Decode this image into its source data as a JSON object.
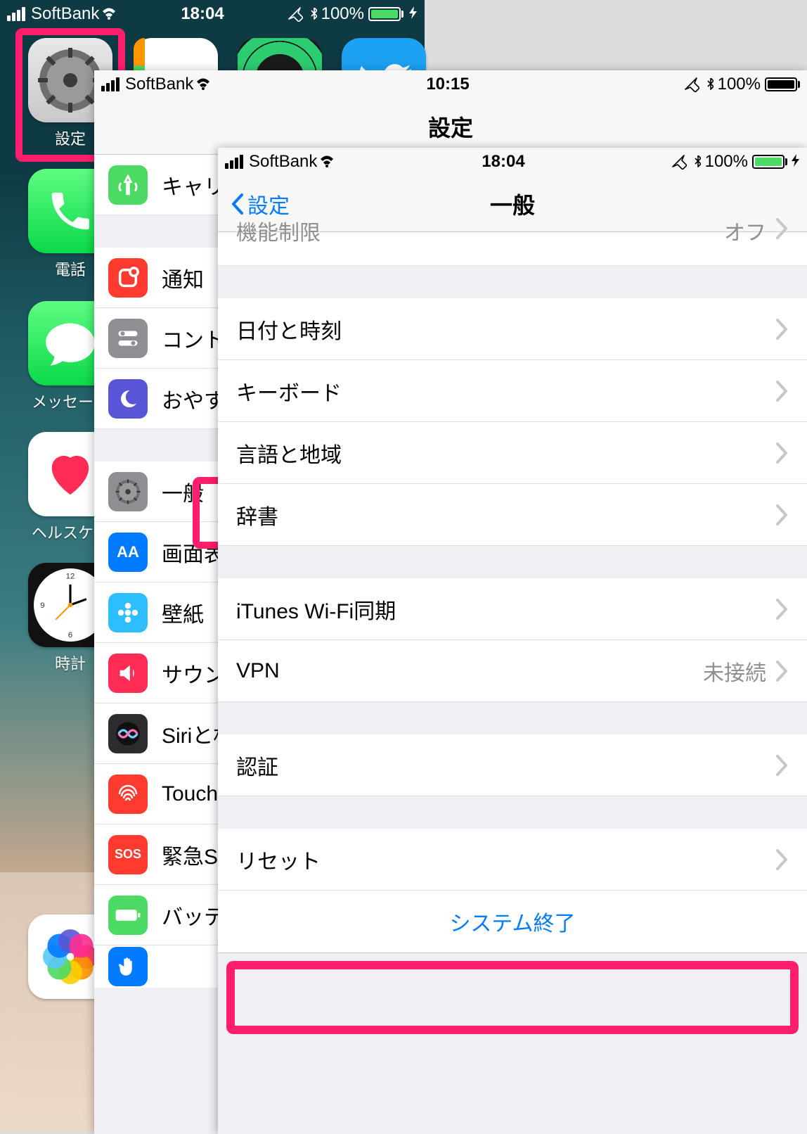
{
  "layer1": {
    "status": {
      "carrier": "SoftBank",
      "time": "18:04",
      "battery_pct": "100%"
    },
    "apps": {
      "settings": "設定",
      "phone": "電話",
      "messages": "メッセー…",
      "health": "ヘルスケ…",
      "clock": "時計"
    }
  },
  "layer2": {
    "status": {
      "carrier": "SoftBank",
      "time": "10:15",
      "battery_pct": "100%"
    },
    "title": "設定",
    "items": {
      "carrier_partial": "キャリ",
      "notifications": "通知",
      "controlcenter": "コント",
      "dnd": "おやす",
      "general": "一般",
      "display": "画面表",
      "wallpaper": "壁紙",
      "sounds": "サウン",
      "siri": "Siriと杉",
      "touchid": "Touch",
      "sos": "緊急SC",
      "battery": "バッテ"
    }
  },
  "layer3": {
    "status": {
      "carrier": "SoftBank",
      "time": "18:04",
      "battery_pct": "100%"
    },
    "back": "設定",
    "title": "一般",
    "rows": {
      "restrictions_partial": "機能制限",
      "restrictions_value": "オフ",
      "datetime": "日付と時刻",
      "keyboard": "キーボード",
      "language": "言語と地域",
      "dictionary": "辞書",
      "itunes": "iTunes Wi-Fi同期",
      "vpn": "VPN",
      "vpn_value": "未接続",
      "regulatory": "認証",
      "reset": "リセット",
      "shutdown": "システム終了"
    }
  }
}
